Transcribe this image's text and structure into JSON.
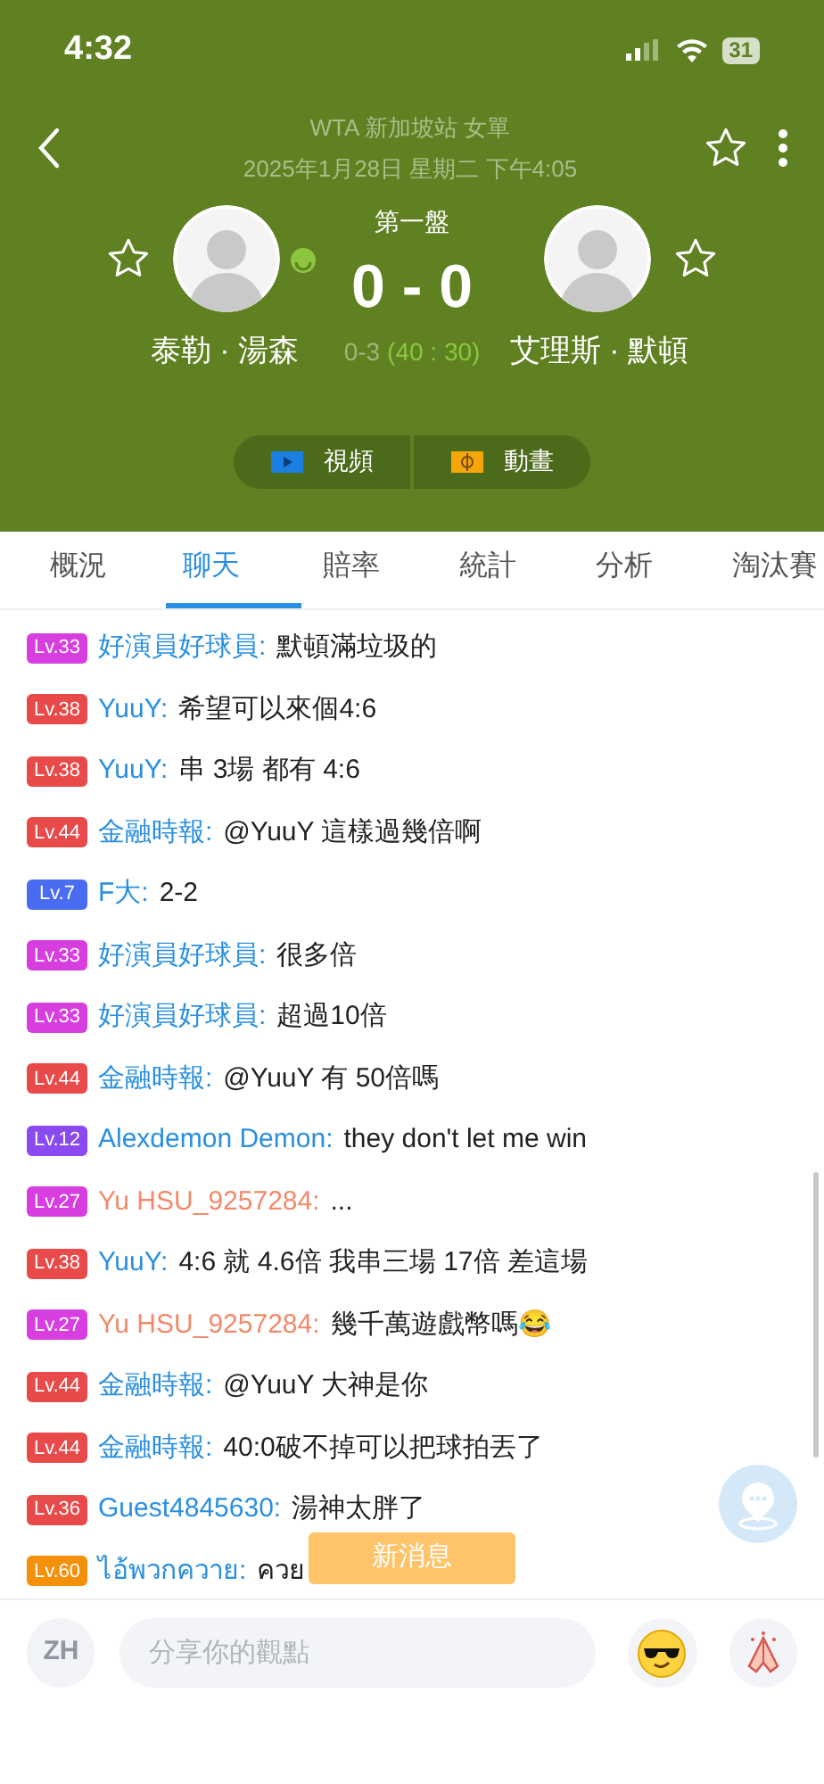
{
  "status_bar": {
    "time": "4:32",
    "battery": "31"
  },
  "header": {
    "event": "WTA 新加坡站 女單",
    "datetime": "2025年1月28日 星期二 下午4:05",
    "favorite": false
  },
  "match": {
    "set_label": "第一盤",
    "score": "0 - 0",
    "game_score": "0-3",
    "point_score": "(40 : 30)",
    "players": [
      {
        "name": "泰勒 · 湯森",
        "favorite": false,
        "serving": true
      },
      {
        "name": "艾理斯 · 默頓",
        "favorite": false,
        "serving": false
      }
    ]
  },
  "media_buttons": [
    {
      "kind": "video",
      "label": "視頻"
    },
    {
      "kind": "animation",
      "label": "動畫"
    }
  ],
  "tabs": [
    {
      "label": "概況",
      "selected": false
    },
    {
      "label": "聊天",
      "selected": true
    },
    {
      "label": "賠率",
      "selected": false
    },
    {
      "label": "統計",
      "selected": false
    },
    {
      "label": "分析",
      "selected": false
    },
    {
      "label": "淘汰賽",
      "selected": false
    }
  ],
  "messages": [
    {
      "level": {
        "text": "Lv.33",
        "color": "#d63ee0"
      },
      "user": {
        "text": "好演員好球員:",
        "color": "#2a8fe0"
      },
      "text": "默頓滿垃圾的"
    },
    {
      "level": {
        "text": "Lv.38",
        "color": "#e84a4a"
      },
      "user": {
        "text": "YuuY:",
        "color": "#2a8fe0"
      },
      "text": "希望可以來個4:6"
    },
    {
      "level": {
        "text": "Lv.38",
        "color": "#e84a4a"
      },
      "user": {
        "text": "YuuY:",
        "color": "#2a8fe0"
      },
      "text": "串 3場 都有 4:6"
    },
    {
      "level": {
        "text": "Lv.44",
        "color": "#e84a4a"
      },
      "user": {
        "text": "金融時報:",
        "color": "#2a8fe0"
      },
      "text": "@YuuY 這樣過幾倍啊"
    },
    {
      "level": {
        "text": "Lv.7",
        "color": "#4a6cf0"
      },
      "user": {
        "text": "F大:",
        "color": "#2a8fe0"
      },
      "text": "2-2"
    },
    {
      "level": {
        "text": "Lv.33",
        "color": "#d63ee0"
      },
      "user": {
        "text": "好演員好球員:",
        "color": "#2a8fe0"
      },
      "text": "很多倍"
    },
    {
      "level": {
        "text": "Lv.33",
        "color": "#d63ee0"
      },
      "user": {
        "text": "好演員好球員:",
        "color": "#2a8fe0"
      },
      "text": "超過10倍"
    },
    {
      "level": {
        "text": "Lv.44",
        "color": "#e84a4a"
      },
      "user": {
        "text": "金融時報:",
        "color": "#2a8fe0"
      },
      "text": "@YuuY 有 50倍嗎"
    },
    {
      "level": {
        "text": "Lv.12",
        "color": "#8a4af0"
      },
      "user": {
        "text": "Alexdemon Demon:",
        "color": "#2a8fe0"
      },
      "text": "they don't let me win"
    },
    {
      "level": {
        "text": "Lv.27",
        "color": "#d63ee0"
      },
      "user": {
        "text": "Yu HSU_9257284:",
        "color": "#f08a6a"
      },
      "text": "..."
    },
    {
      "level": {
        "text": "Lv.38",
        "color": "#e84a4a"
      },
      "user": {
        "text": "YuuY:",
        "color": "#2a8fe0"
      },
      "text": "4:6 就 4.6倍 我串三場 17倍 差這場"
    },
    {
      "level": {
        "text": "Lv.27",
        "color": "#d63ee0"
      },
      "user": {
        "text": "Yu HSU_9257284:",
        "color": "#f08a6a"
      },
      "text": "幾千萬遊戲幣嗎😂"
    },
    {
      "level": {
        "text": "Lv.44",
        "color": "#e84a4a"
      },
      "user": {
        "text": "金融時報:",
        "color": "#2a8fe0"
      },
      "text": "@YuuY 大神是你"
    },
    {
      "level": {
        "text": "Lv.44",
        "color": "#e84a4a"
      },
      "user": {
        "text": "金融時報:",
        "color": "#2a8fe0"
      },
      "text": "40:0破不掉可以把球拍丟了"
    },
    {
      "level": {
        "text": "Lv.36",
        "color": "#e84a4a"
      },
      "user": {
        "text": "Guest4845630:",
        "color": "#2a8fe0"
      },
      "text": "湯神太胖了"
    },
    {
      "level": {
        "text": "Lv.60",
        "color": "#f5900a"
      },
      "user": {
        "text": "ไอ้พวกควาย:",
        "color": "#2a8fe0"
      },
      "text": "ควย"
    }
  ],
  "new_message_toast": "新消息",
  "input_bar": {
    "language": "ZH",
    "placeholder": "分享你的觀點"
  }
}
